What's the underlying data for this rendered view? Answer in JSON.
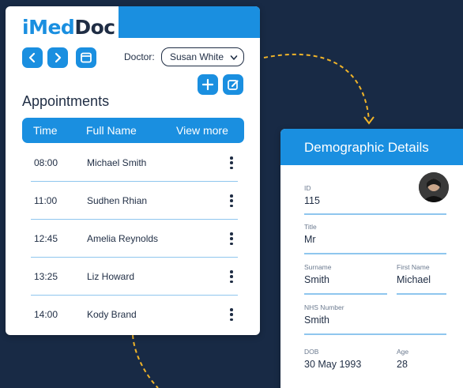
{
  "app": {
    "logo_i": "i",
    "logo_med": "Med",
    "logo_doc": "Doc"
  },
  "toolbar": {
    "prev_icon": "chevron-left-icon",
    "next_icon": "chevron-right-icon",
    "calendar_icon": "calendar-icon",
    "add_icon": "plus-icon",
    "edit_icon": "edit-icon"
  },
  "doctor": {
    "label": "Doctor:",
    "selected": "Susan White"
  },
  "appointments": {
    "title": "Appointments",
    "columns": [
      "Time",
      "Full Name",
      "View more"
    ],
    "rows": [
      {
        "time": "08:00",
        "name": "Michael Smith"
      },
      {
        "time": "11:00",
        "name": "Sudhen Rhian"
      },
      {
        "time": "12:45",
        "name": "Amelia Reynolds"
      },
      {
        "time": "13:25",
        "name": "Liz Howard"
      },
      {
        "time": "14:00",
        "name": "Kody Brand"
      }
    ]
  },
  "demographics": {
    "title": "Demographic Details",
    "id_label": "ID",
    "id_value": "115",
    "title_label": "Title",
    "title_value": "Mr",
    "surname_label": "Surname",
    "surname_value": "Smith",
    "first_name_label": "First Name",
    "first_name_value": "Michael",
    "nhs_label": "NHS Number",
    "nhs_value": "Smith",
    "dob_label": "DOB",
    "dob_value": "30 May 1993",
    "age_label": "Age",
    "age_value": "28"
  },
  "colors": {
    "background": "#182a45",
    "accent": "#1a8fe0",
    "text": "#1f2d44",
    "divider": "#8fc6ee",
    "connector": "#f0b429"
  }
}
